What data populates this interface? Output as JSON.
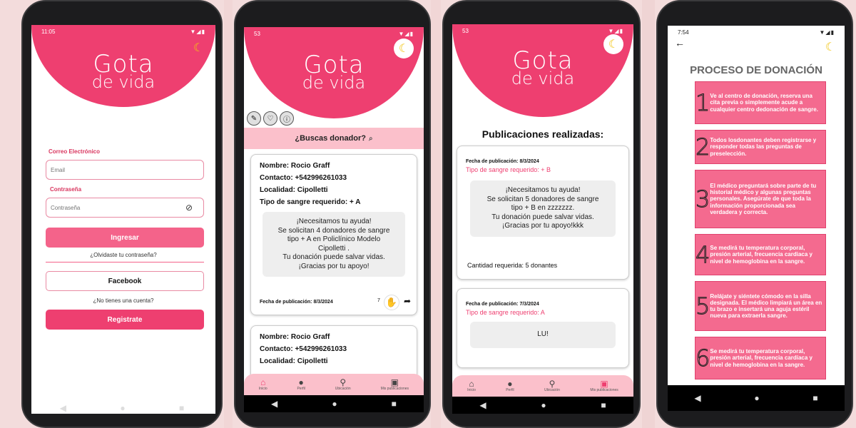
{
  "screen1": {
    "status_time": "11:05",
    "status_icons": "▼◢▮",
    "logo_line1": "Gota",
    "logo_line2": "de vida",
    "email_label": "Correo Electrónico",
    "email_placeholder": "Email",
    "password_label": "Contraseña",
    "password_placeholder": "Contraseña",
    "login_button": "Ingresar",
    "forgot_link": "¿Olvidaste tu contraseña?",
    "facebook_button": "Facebook",
    "no_account": "¿No tienes una cuenta?",
    "register_button": "Registrate"
  },
  "screen2": {
    "status_time": "53",
    "status_icons": "▼◢▮",
    "logo_line1": "Gota",
    "logo_line2": "de vida",
    "search_title": "¿Buscas donador?",
    "card1": {
      "name": "Nombre: Rocio Graff",
      "contact": "Contacto: +542996261033",
      "locality": "Localidad: Cipolletti",
      "blood": "Tipo de sangre requerido: + A",
      "message": [
        "¡Necesitamos tu ayuda!",
        "Se solicitan 4 donadores de sangre",
        "tipo + A en Policlínico Modelo",
        "Cipolletti .",
        "Tu donación puede salvar vidas.",
        "¡Gracias por tu apoyo!"
      ],
      "date": "Fecha de publicación: 8/3/2024",
      "likes": "7"
    },
    "card2": {
      "name": "Nombre: Rocio Graff",
      "contact": "Contacto: +542996261033",
      "locality": "Localidad: Cipolletti"
    },
    "nav": [
      "Inicio",
      "Perfil",
      "Ubicación",
      "Mis publicaciones"
    ]
  },
  "screen3": {
    "status_time": "53",
    "status_icons": "▼◢▮",
    "logo_line1": "Gota",
    "logo_line2": "de vida",
    "title": "Publicaciones realizadas:",
    "pub1": {
      "date": "Fecha de publicación: 8/3/2024",
      "blood": "Tipo de sangre requerido: + B",
      "message": [
        "¡Necesitamos tu ayuda!",
        "Se solicitan 5 donadores de sangre",
        "tipo + B en zzzzzzz.",
        "Tu donación puede salvar vidas.",
        "¡Gracias por tu apoyo!kkk"
      ],
      "quantity": "Cantidad requerida: 5 donantes"
    },
    "pub2": {
      "date": "Fecha de publicación: 7/3/2024",
      "blood": "Tipo de sangre requerido: A",
      "message": [
        "LU!"
      ]
    },
    "nav": [
      "Inicio",
      "Perfil",
      "Ubicación",
      "Mis publicaciones"
    ]
  },
  "screen4": {
    "status_time": "7:54",
    "status_icons": "▼◢▮",
    "title": "PROCESO DE DONACIÓN",
    "steps": [
      {
        "num": "1",
        "text": "Ve al centro de donación, reserva una cita previa o simplemente acude a cualquier centro dedonación de sangre."
      },
      {
        "num": "2",
        "text": "Todos losdonantes deben registrarse y responder todas las preguntas de preselección."
      },
      {
        "num": "3",
        "text": "El médico preguntará sobre parte de tu historial médico y algunas preguntas personales. Asegúrate de que toda la información proporcionada sea verdadera y correcta."
      },
      {
        "num": "4",
        "text": "Se medirá tu temperatura corporal, presión arterial, frecuencia cardiaca y nivel de hemoglobina en la sangre."
      },
      {
        "num": "5",
        "text": "Relájate y siéntete cómodo en la silla designada. El médico limpiará un área en tu brazo e insertará una aguja estéril nueva para extraerla sangre."
      },
      {
        "num": "6",
        "text": "Se medirá tu temperatura corporal, presión arterial, frecuencia cardíaca y nivel de hemoglobina en la sangre."
      }
    ]
  },
  "colors": {
    "brand": "#ee3f70",
    "brand_light": "#fbc0cb",
    "button": "#f4638a"
  }
}
